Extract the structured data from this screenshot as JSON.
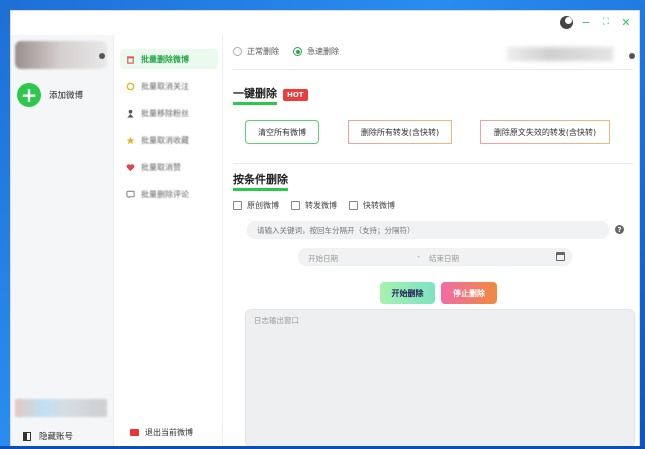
{
  "window": {
    "controls": {
      "minimize": "−",
      "maximize": "⛶",
      "close": "✕"
    }
  },
  "sidebar_left": {
    "add_account_label": "添加微博",
    "hide_account_label": "隐藏账号"
  },
  "nav": {
    "items": [
      {
        "label": "批量删除微博",
        "icon": "trash-icon",
        "icon_color": "#e04848",
        "active": true
      },
      {
        "label": "批量取消关注",
        "icon": "heart-outline-icon",
        "icon_color": "#f0b020",
        "active": false
      },
      {
        "label": "批量移除粉丝",
        "icon": "person-icon",
        "icon_color": "#555555",
        "active": false
      },
      {
        "label": "批量取消收藏",
        "icon": "star-icon",
        "icon_color": "#f0b020",
        "active": false
      },
      {
        "label": "批量取消赞",
        "icon": "heart-icon",
        "icon_color": "#e04848",
        "active": false
      },
      {
        "label": "批量删除评论",
        "icon": "comment-icon",
        "icon_color": "#888888",
        "active": false
      }
    ],
    "logout_label": "退出当前微博"
  },
  "main": {
    "mode": {
      "options": [
        "正常删除",
        "急速删除"
      ],
      "selected_index": 1
    },
    "quick_delete": {
      "title": "一键删除",
      "badge": "HOT",
      "buttons": [
        "清空所有微博",
        "删除所有转发(含快转)",
        "删除原文失效的转发(含快转)"
      ]
    },
    "conditional_delete": {
      "title": "按条件删除",
      "checkboxes": [
        "原创微博",
        "转发微博",
        "快转微博"
      ],
      "keyword_placeholder": "请输入关键词，按回车分隔开（支持；分隔符）",
      "date_start_placeholder": "开始日期",
      "date_separator": "-",
      "date_end_placeholder": "结束日期",
      "start_button": "开始删除",
      "stop_button": "停止删除"
    },
    "log_placeholder": "日志输出窗口"
  },
  "colors": {
    "accent_green": "#2cc84b",
    "hot_red": "#ee3b3b",
    "desktop_blue": "#1d6fd6"
  }
}
